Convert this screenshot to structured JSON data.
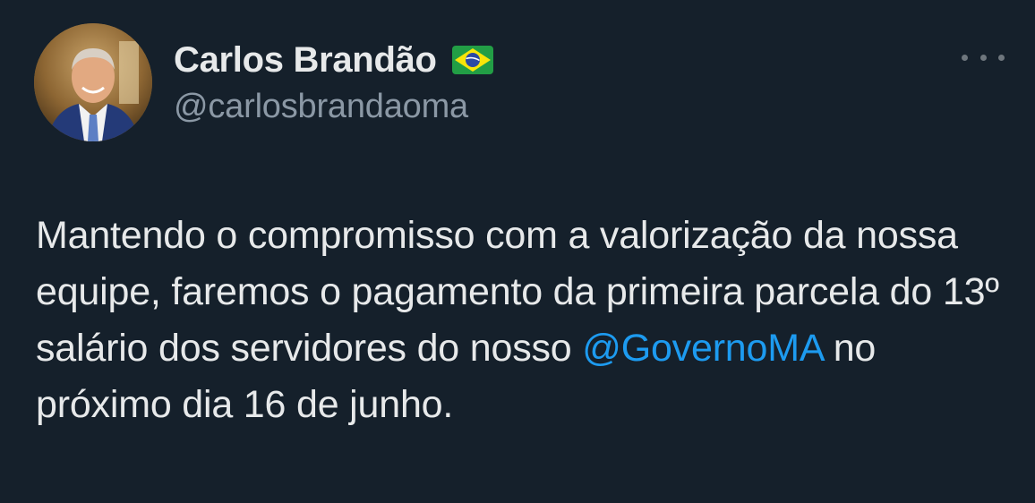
{
  "author": {
    "display_name": "Carlos Brandão",
    "handle": "@carlosbrandaoma",
    "flag_icon": "brazil-flag-icon",
    "avatar_icon": "profile-photo"
  },
  "tweet": {
    "text_before_mention": "Mantendo o compromisso com a valorização da nossa equipe, faremos o pagamento da primeira parcela do 13º salário dos servidores do nosso",
    "mention": "@GovernoMA",
    "text_after_mention": " no próximo dia 16 de junho."
  },
  "menu": {
    "more_icon": "more-options-icon"
  },
  "colors": {
    "background": "#15202b",
    "text": "#e7e9ea",
    "secondary_text": "#8b98a5",
    "link": "#1d9bf0"
  }
}
